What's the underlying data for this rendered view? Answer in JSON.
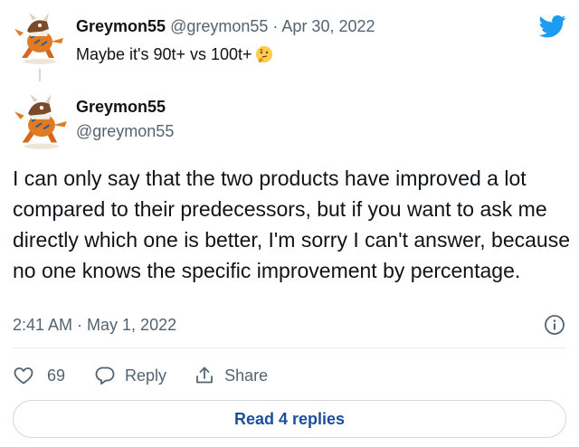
{
  "parent_tweet": {
    "display_name": "Greymon55",
    "handle": "@greymon55",
    "separator": "·",
    "date": "Apr 30, 2022",
    "text": "Maybe it's 90t+ vs 100t+",
    "emoji": "thinking-face-icon"
  },
  "tweet": {
    "display_name": "Greymon55",
    "handle": "@greymon55",
    "text": "I can only say that the two products have improved a lot compared to their predecessors, but if you want to ask me directly which one is better, I'm sorry I can't answer, because no one knows the specific improvement by percentage.",
    "timestamp": "2:41 AM · May 1, 2022"
  },
  "actions": {
    "like_count": "69",
    "reply_label": "Reply",
    "share_label": "Share"
  },
  "read_replies_label": "Read 4 replies",
  "colors": {
    "twitter_blue": "#1d9bf0",
    "link_blue": "#1d4e9c",
    "text": "#0f1419",
    "muted": "#536471",
    "border": "#cfd9de"
  },
  "icons": [
    "twitter-bird-icon",
    "heart-icon",
    "reply-bubble-icon",
    "share-icon",
    "info-icon",
    "avatar-dinosaur"
  ]
}
